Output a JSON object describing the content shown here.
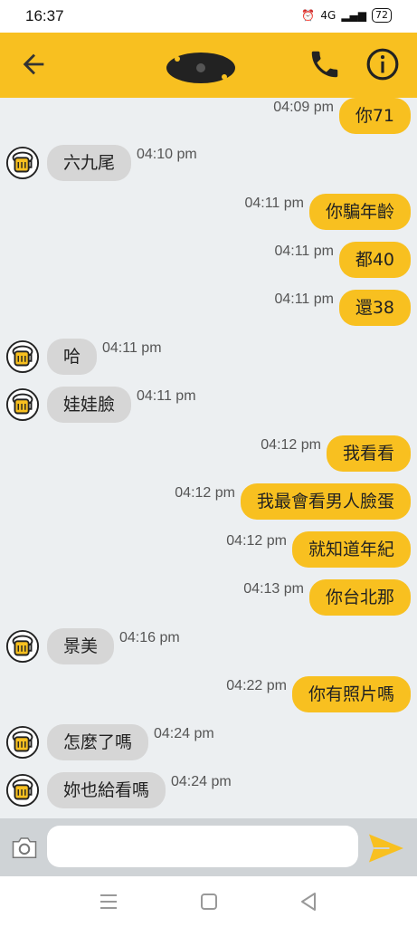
{
  "status_bar": {
    "time": "16:37",
    "network": "4G",
    "battery": "72"
  },
  "header": {
    "accent": "#F8C020"
  },
  "messages": [
    {
      "dir": "out",
      "text": "你71",
      "time": "04:09 pm"
    },
    {
      "dir": "in",
      "text": "六九尾",
      "time": "04:10 pm"
    },
    {
      "dir": "out",
      "text": "你騙年齡",
      "time": "04:11 pm"
    },
    {
      "dir": "out",
      "text": "都40",
      "time": "04:11 pm"
    },
    {
      "dir": "out",
      "text": "還38",
      "time": "04:11 pm"
    },
    {
      "dir": "in",
      "text": "哈",
      "time": "04:11 pm"
    },
    {
      "dir": "in",
      "text": "娃娃臉",
      "time": "04:11 pm"
    },
    {
      "dir": "out",
      "text": "我看看",
      "time": "04:12 pm"
    },
    {
      "dir": "out",
      "text": "我最會看男人臉蛋",
      "time": "04:12 pm"
    },
    {
      "dir": "out",
      "text": "就知道年紀",
      "time": "04:12 pm"
    },
    {
      "dir": "out",
      "text": "你台北那",
      "time": "04:13 pm"
    },
    {
      "dir": "in",
      "text": "景美",
      "time": "04:16 pm"
    },
    {
      "dir": "out",
      "text": "你有照片嗎",
      "time": "04:22 pm"
    },
    {
      "dir": "in",
      "text": "怎麼了嗎",
      "time": "04:24 pm"
    },
    {
      "dir": "in",
      "text": "妳也給看嗎",
      "time": "04:24 pm"
    }
  ],
  "input": {
    "value": "",
    "placeholder": ""
  }
}
